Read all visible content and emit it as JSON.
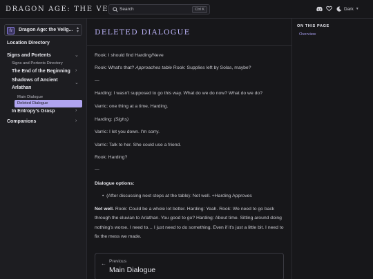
{
  "header": {
    "site_title": "DRAGON AGE: THE VEILGUARD",
    "search_placeholder": "Search",
    "search_shortcut": "Ctrl K",
    "theme_label": "Dark"
  },
  "sidebar": {
    "site_selector": "Dragon Age: the Veilg...",
    "items": [
      {
        "label": "Location Directory"
      },
      {
        "label": "Signs and Portents"
      },
      {
        "label": "Signs and Portents Directory"
      },
      {
        "label": "The End of the Beginning"
      },
      {
        "label": "Shadows of Ancient"
      },
      {
        "label": "Arlathan"
      },
      {
        "label": "Main Dialogue"
      },
      {
        "label": "Deleted Dialogue"
      },
      {
        "label": "In Entropy's Grasp"
      },
      {
        "label": "Companions"
      }
    ]
  },
  "main": {
    "title": "DELETED DIALOGUE",
    "lines": [
      "Rook: I should find Harding/Neve",
      "Rook: What's that?",
      "Approaches table",
      "Rook: Supplies left by Solas, maybe?",
      "—",
      "Harding: I wasn't supposed to go this way. What do we do now? What do we do?",
      "Varric: one thing at a time, Harding.",
      "Harding:",
      "(Sighs)",
      "Varric: I let you down. I'm sorry.",
      "Varric: Talk to her. She could use a friend.",
      "Rook: Harding?",
      "—",
      "Dialogue options:",
      "(After discussing next steps at the table): Not well. +Harding Approves",
      "Not well.",
      "Rook: Could be a whole lot better. Harding: Yeah. Rook: We need to go back through the eluvian to Arlathan. You good to go? Harding: About time. Sitting around doing nothing's worse. I need to… I just need to do something. Even if it's just a little bit. I need to fix the mess we made."
    ],
    "prev_small": "Previous",
    "prev_title": "Main Dialogue"
  },
  "toc": {
    "heading": "ON THIS PAGE",
    "links": [
      "Overview"
    ]
  },
  "colors": {
    "accent": "#b0a4f0",
    "background": "#17171a",
    "sidebar": "#1d1d21"
  }
}
